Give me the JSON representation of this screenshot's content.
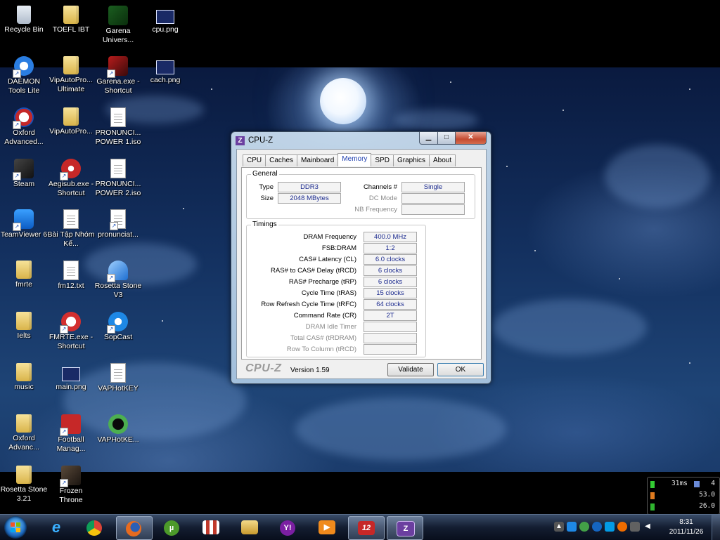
{
  "desktop": {
    "icons": [
      {
        "label": "Recycle Bin",
        "icon": "recycle-bin-icon"
      },
      {
        "label": "TOEFL IBT",
        "icon": "folder-icon"
      },
      {
        "label": "Garena Univers...",
        "icon": "garena-icon"
      },
      {
        "label": "cpu.png",
        "icon": "image-file-icon"
      },
      {
        "label": "DAEMON Tools Lite",
        "icon": "daemon-tools-icon"
      },
      {
        "label": "VipAutoPro... Ultimate",
        "icon": "folder-icon"
      },
      {
        "label": "Garena.exe - Shortcut",
        "icon": "garena-icon"
      },
      {
        "label": "cach.png",
        "icon": "image-file-icon"
      },
      {
        "label": "Oxford Advanced...",
        "icon": "oxford-icon"
      },
      {
        "label": "VipAutoPro...",
        "icon": "folder-icon"
      },
      {
        "label": "PRONUNCI... POWER 1.iso",
        "icon": "disc-image-icon"
      },
      {
        "label": "Steam",
        "icon": "steam-icon"
      },
      {
        "label": "Aegisub.exe - Shortcut",
        "icon": "aegisub-icon"
      },
      {
        "label": "PRONUNCI... POWER 2.iso",
        "icon": "disc-image-icon"
      },
      {
        "label": "TeamViewer 6",
        "icon": "teamviewer-icon"
      },
      {
        "label": "Bài Tập Nhóm Kế...",
        "icon": "document-icon"
      },
      {
        "label": "pronunciat...",
        "icon": "document-icon"
      },
      {
        "label": "fmrte",
        "icon": "folder-icon"
      },
      {
        "label": "fm12.txt",
        "icon": "text-file-icon"
      },
      {
        "label": "Rosetta Stone V3",
        "icon": "rosetta-stone-icon"
      },
      {
        "label": "Ielts",
        "icon": "folder-icon"
      },
      {
        "label": "FMRTE.exe - Shortcut",
        "icon": "fmrte-icon"
      },
      {
        "label": "SopCast",
        "icon": "sopcast-icon"
      },
      {
        "label": "music",
        "icon": "folder-icon"
      },
      {
        "label": "main.png",
        "icon": "image-file-icon"
      },
      {
        "label": "VAPHotKEY",
        "icon": "blank-file-icon"
      },
      {
        "label": "Oxford Advanc...",
        "icon": "folder-icon"
      },
      {
        "label": "Football Manag...",
        "icon": "football-manager-icon"
      },
      {
        "label": "VAPHotKE...",
        "icon": "vaphotkey-icon"
      },
      {
        "label": "Rosetta Stone 3.21",
        "icon": "folder-icon"
      },
      {
        "label": "Frozen Throne",
        "icon": "frozen-throne-icon"
      }
    ]
  },
  "cpuz": {
    "title": "CPU-Z",
    "tabs": [
      "CPU",
      "Caches",
      "Mainboard",
      "Memory",
      "SPD",
      "Graphics",
      "About"
    ],
    "active_tab": "Memory",
    "general": {
      "title": "General",
      "type_label": "Type",
      "type_value": "DDR3",
      "size_label": "Size",
      "size_value": "2048 MBytes",
      "channels_label": "Channels #",
      "channels_value": "Single",
      "dcmode_label": "DC Mode",
      "dcmode_value": "",
      "nbfreq_label": "NB Frequency",
      "nbfreq_value": ""
    },
    "timings": {
      "title": "Timings",
      "rows": [
        {
          "label": "DRAM Frequency",
          "value": "400.0 MHz",
          "enabled": true
        },
        {
          "label": "FSB:DRAM",
          "value": "1:2",
          "enabled": true
        },
        {
          "label": "CAS# Latency (CL)",
          "value": "6.0 clocks",
          "enabled": true
        },
        {
          "label": "RAS# to CAS# Delay (tRCD)",
          "value": "6 clocks",
          "enabled": true
        },
        {
          "label": "RAS# Precharge (tRP)",
          "value": "6 clocks",
          "enabled": true
        },
        {
          "label": "Cycle Time (tRAS)",
          "value": "15 clocks",
          "enabled": true
        },
        {
          "label": "Row Refresh Cycle Time (tRFC)",
          "value": "64 clocks",
          "enabled": true
        },
        {
          "label": "Command Rate (CR)",
          "value": "2T",
          "enabled": true
        },
        {
          "label": "DRAM Idle Timer",
          "value": "",
          "enabled": false
        },
        {
          "label": "Total CAS# (tRDRAM)",
          "value": "",
          "enabled": false
        },
        {
          "label": "Row To Column (tRCD)",
          "value": "",
          "enabled": false
        }
      ]
    },
    "footer": {
      "logo": "CPU-Z",
      "version": "Version 1.59",
      "validate_label": "Validate",
      "ok_label": "OK"
    }
  },
  "gadget": {
    "ping": "31ms",
    "ping_count": "4",
    "value_2": "53.0",
    "value_3": "26.0"
  },
  "taskbar": {
    "apps": [
      {
        "name": "internet-explorer-icon",
        "glyph": "e",
        "color": "#1e90e0"
      },
      {
        "name": "chrome-icon",
        "glyph": "",
        "color": "#d33"
      },
      {
        "name": "firefox-icon",
        "glyph": "",
        "color": "#e86b1f"
      },
      {
        "name": "utorrent-icon",
        "glyph": "µ",
        "color": "#4c9a2a"
      },
      {
        "name": "unikey-icon",
        "glyph": "",
        "color": "#c0392b"
      },
      {
        "name": "explorer-icon",
        "glyph": "",
        "color": "#d8b44a"
      },
      {
        "name": "yahoo-messenger-icon",
        "glyph": "Y!",
        "color": "#7b1fa2"
      },
      {
        "name": "media-player-icon",
        "glyph": "▶",
        "color": "#f08a1c"
      },
      {
        "name": "football-manager-icon",
        "glyph": "12",
        "color": "#c62828"
      },
      {
        "name": "cpuz-icon",
        "glyph": "Z",
        "color": "#6b3fa0"
      }
    ],
    "clock_time": "8:31",
    "clock_date": "2011/11/26"
  }
}
